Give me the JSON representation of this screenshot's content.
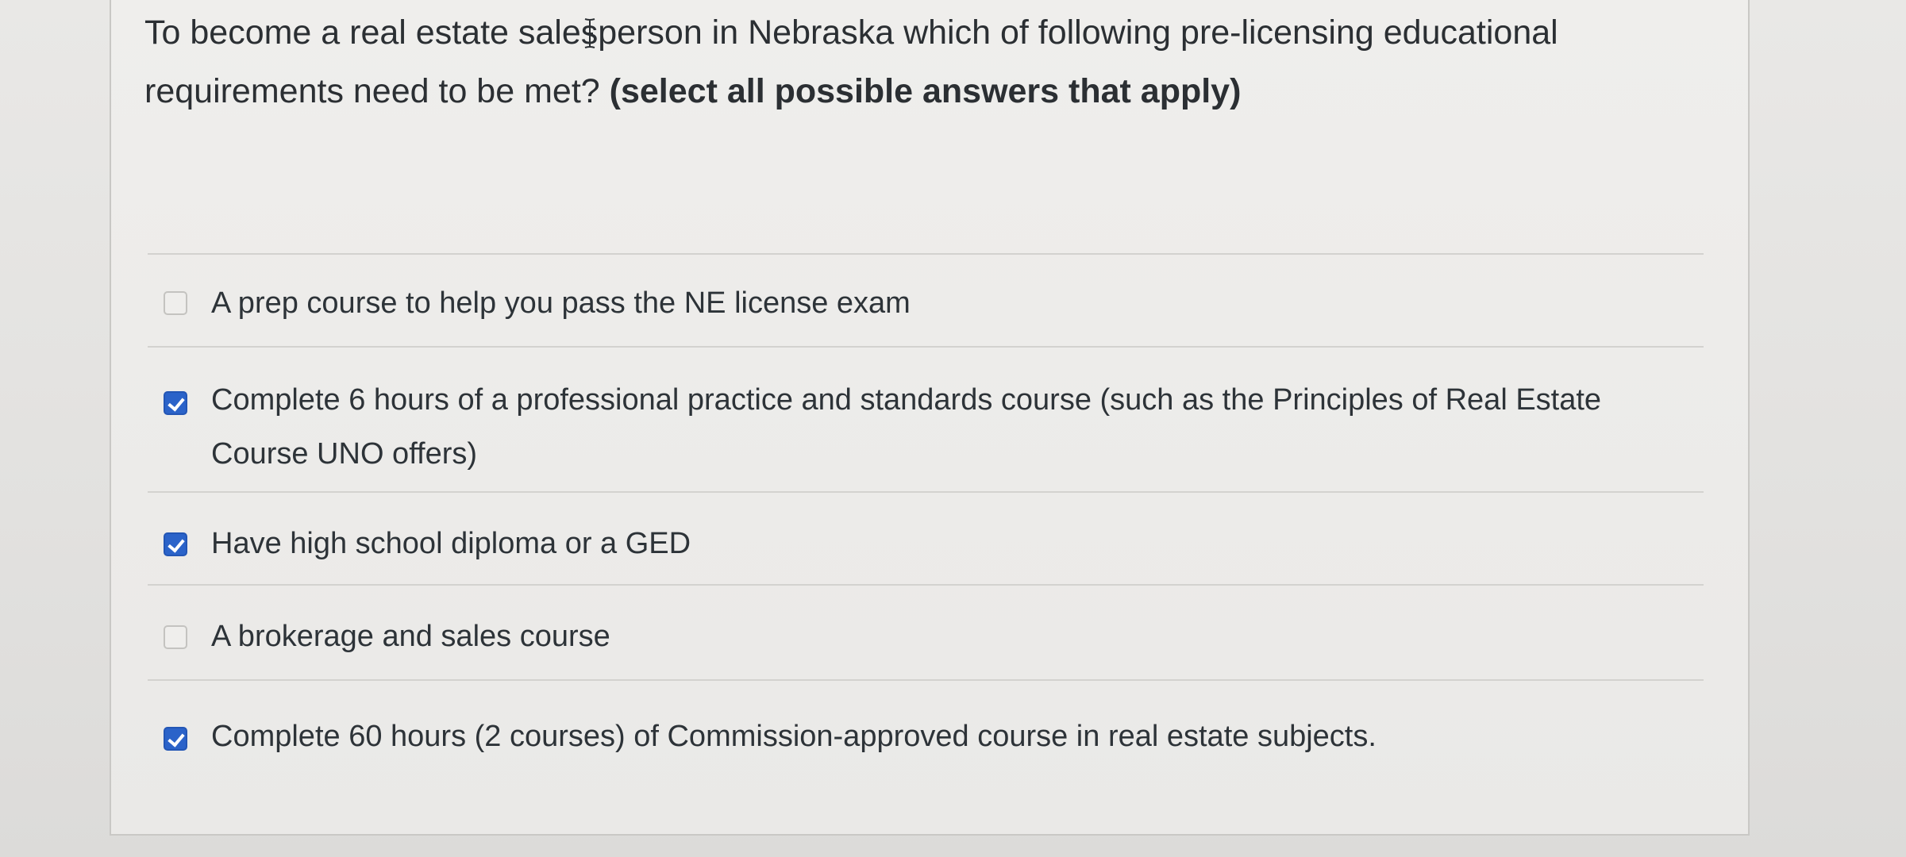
{
  "question": {
    "text": "To become a real estate salesperson in Nebraska which of following pre-licensing educational requirements need to be met?",
    "instruction": "(select all possible answers that apply)"
  },
  "answers": [
    {
      "label": "A prep course to help you pass the NE license exam",
      "checked": false
    },
    {
      "label": "Complete 6 hours of a professional practice and standards course (such as the Principles of Real Estate Course UNO offers)",
      "checked": true
    },
    {
      "label": "Have high school diploma or a GED",
      "checked": true
    },
    {
      "label": "A brokerage and sales course",
      "checked": false
    },
    {
      "label": "Complete 60 hours (2 courses) of Commission-approved course in real estate subjects.",
      "checked": true
    }
  ],
  "colors": {
    "checkbox_checked": "#2b63c9",
    "text": "#2d3338"
  },
  "icons": {
    "cursor": "text-cursor-icon"
  }
}
